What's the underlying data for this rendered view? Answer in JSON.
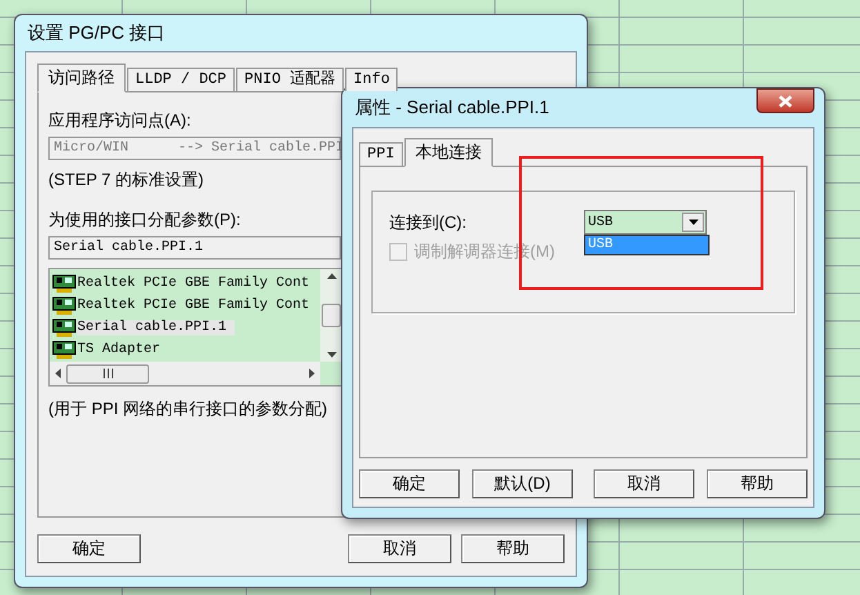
{
  "main_window": {
    "title": "设置 PG/PC 接口",
    "tabs": [
      {
        "label": "访问路径",
        "selected": true
      },
      {
        "label": "LLDP / DCP",
        "selected": false
      },
      {
        "label": "PNIO 适配器",
        "selected": false
      },
      {
        "label": "Info",
        "selected": false
      }
    ],
    "access_point": {
      "label": "应用程序访问点(A):",
      "value": "Micro/WIN      --> Serial cable.PPI"
    },
    "standard_note": "(STEP 7 的标准设置)",
    "parameter_field": {
      "label": "为使用的接口分配参数(P):",
      "value": "Serial cable.PPI.1"
    },
    "interfaces": [
      {
        "label": "Realtek PCIe GBE Family Cont",
        "selected": false
      },
      {
        "label": "Realtek PCIe GBE Family Cont",
        "selected": false
      },
      {
        "label": "Serial cable.PPI.1",
        "selected": true
      },
      {
        "label": "TS Adapter",
        "selected": false
      }
    ],
    "description": "(用于 PPI 网络的串行接口的参数分配)",
    "buttons": [
      "确定",
      "取消",
      "帮助"
    ]
  },
  "dialog": {
    "title": "属性 - Serial cable.PPI.1",
    "tabs": [
      {
        "label": "PPI",
        "selected": false
      },
      {
        "label": "本地连接",
        "selected": true
      }
    ],
    "connect_to": {
      "label": "连接到(C):",
      "value": "USB",
      "options": [
        {
          "label": "USB",
          "selected": true
        }
      ]
    },
    "modem": {
      "label": "调制解调器连接(M)",
      "checked": false,
      "disabled": true
    },
    "buttons": [
      "确定",
      "默认(D)",
      "取消",
      "帮助"
    ]
  }
}
